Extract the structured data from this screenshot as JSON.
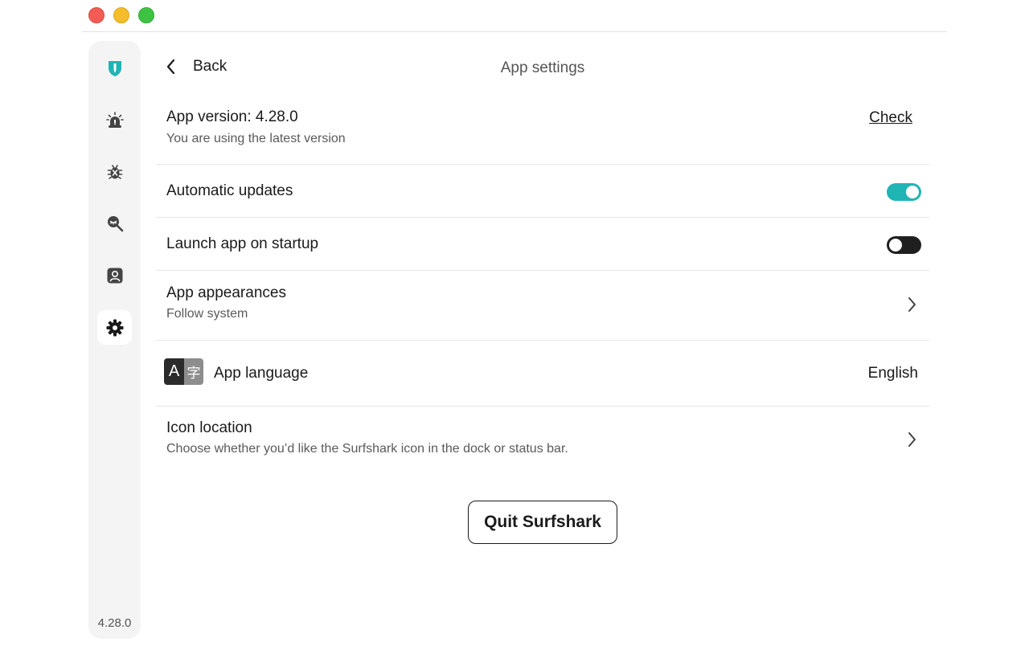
{
  "header": {
    "back_label": "Back",
    "title": "App settings"
  },
  "sidebar": {
    "items": [
      {
        "name": "surfshark-logo-icon",
        "active": false
      },
      {
        "name": "alert-icon",
        "active": false
      },
      {
        "name": "antivirus-icon",
        "active": false
      },
      {
        "name": "search-icon",
        "active": false
      },
      {
        "name": "account-icon",
        "active": false
      },
      {
        "name": "gear-icon",
        "active": true
      }
    ],
    "version": "4.28.0",
    "accent_color": "#1fb5b4"
  },
  "settings": {
    "version": {
      "title": "App version: 4.28.0",
      "subtitle": "You are using the latest version",
      "action": "Check"
    },
    "auto_updates": {
      "title": "Automatic updates",
      "enabled": true
    },
    "launch_startup": {
      "title": "Launch app on startup",
      "enabled": false
    },
    "appearance": {
      "title": "App appearances",
      "subtitle": "Follow system"
    },
    "language": {
      "title": "App language",
      "value": "English",
      "badge_latin": "A",
      "badge_cjk": "字"
    },
    "icon_location": {
      "title": "Icon location",
      "subtitle": "Choose whether you’d like the Surfshark icon in the dock or status bar."
    }
  },
  "quit_label": "Quit Surfshark"
}
